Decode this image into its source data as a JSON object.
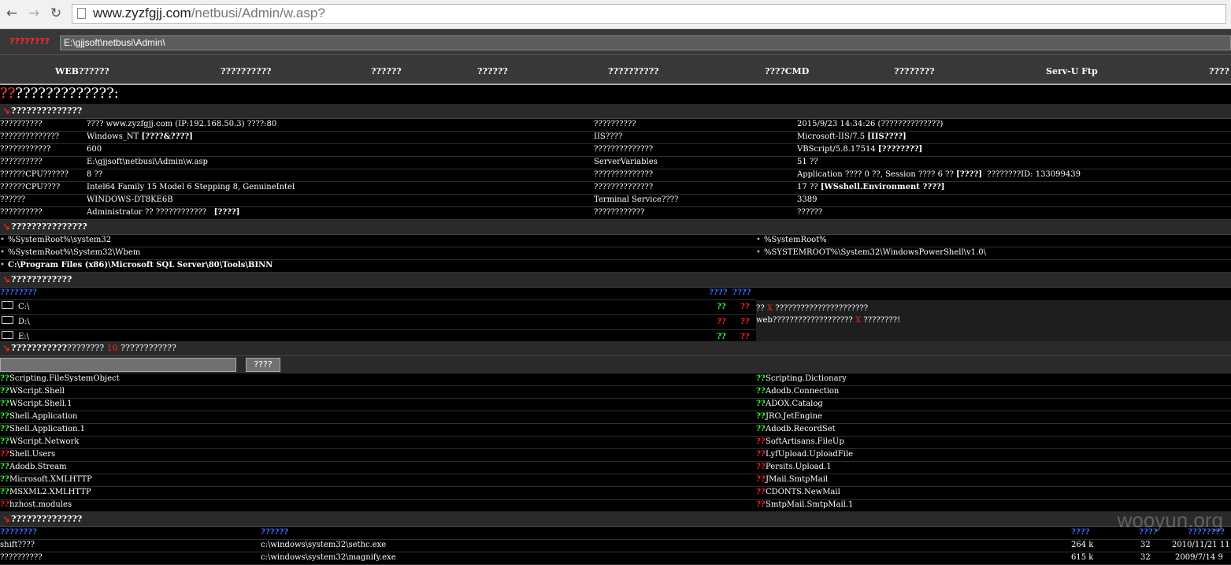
{
  "browser": {
    "url_host": "www.zyzfgjj.com",
    "url_path": "/netbusi/Admin/w.asp?"
  },
  "pathbar": {
    "label": "????????",
    "value": "E:\\gjjsoft\\netbusi\\Admin\\"
  },
  "menu": [
    "WEB??????",
    "??????????",
    "??????",
    "??????",
    "??????????",
    "????CMD",
    "????????",
    "Serv-U Ftp",
    "????"
  ],
  "page_title": {
    "text": "???????????????:",
    "suffix": "??"
  },
  "section1": {
    "title": "??????????????",
    "rows": [
      {
        "k1": "??????????",
        "v1": "???? www.zyzfgjj.com (IP:192.168.50.3) ????:80",
        "v1b": "",
        "k2": "??????????",
        "v2": "2015/9/23 14:34:26 (??????????????)",
        "v2b": ""
      },
      {
        "k1": "??????????????",
        "v1": "Windows_NT ",
        "v1b": "[????&????]",
        "k2": "IIS????",
        "v2": "Microsoft-IIS/7.5 ",
        "v2b": "[IIS????]"
      },
      {
        "k1": "????????????",
        "v1": "600",
        "v1b": "",
        "k2": "??????????????",
        "v2": "VBScript/5.8.17514 ",
        "v2b": "[????????]"
      },
      {
        "k1": "??????????",
        "v1": "E:\\gjjsoft\\netbusi\\Admin\\w.asp",
        "v1b": "",
        "k2": "ServerVariables",
        "v2": "51 ??",
        "v2b": ""
      },
      {
        "k1": "??????CPU??????",
        "v1": "8 ??",
        "v1b": "",
        "k2": "??????????????",
        "v2": "Application ???? 0 ??, Session ???? 6 ?? ",
        "v2b": "[????]",
        "v2c": "  ????????ID: 133099439"
      },
      {
        "k1": "??????CPU????",
        "v1": "Intel64 Family 15 Model 6 Stepping 8, GenuineIntel",
        "v1b": "",
        "k2": "??????????????",
        "v2": "17 ?? ",
        "v2b": "[WSshell.Environment ????]"
      },
      {
        "k1": "??????",
        "v1": "WINDOWS-DT8KE6B",
        "v1b": "",
        "k2": "Terminal Service????",
        "v2": "3389",
        "v2b": ""
      },
      {
        "k1": "??????????",
        "v1": "Administrator ?? ????????????   ",
        "v1b": "[????]",
        "k2": "????????????",
        "v2": "??????",
        "v2b": ""
      }
    ]
  },
  "section2": {
    "title": "???????????????",
    "rows": [
      {
        "left": "%SystemRoot%\\system32",
        "right": "%SystemRoot%"
      },
      {
        "left": "%SystemRoot%\\System32\\Wbem",
        "right": "%SYSTEMROOT%\\System32\\WindowsPowerShell\\v1.0\\"
      }
    ],
    "bold_row": "C:\\Program Files (x86)\\Microsoft SQL Server\\80\\Tools\\BINN"
  },
  "section3": {
    "title": "????????????",
    "header_left": "????????",
    "header_mid1": "????",
    "header_mid2": "????",
    "drives": [
      {
        "name": "C:\\",
        "s1": "??",
        "s2": "??",
        "s1ok": true
      },
      {
        "name": "D:\\",
        "s1": "??",
        "s2": "??",
        "s1ok": false
      },
      {
        "name": "E:\\",
        "s1": "??",
        "s2": "??",
        "s1ok": true
      }
    ],
    "note1_a": "?? ",
    "note1_b": "X",
    "note1_c": " ??????????????????????",
    "note2_a": "web??????????????????? ",
    "note2_b": "X",
    "note2_c": " ????????!"
  },
  "section4": {
    "title": "???????????",
    "title_rest": "????????",
    "count": "10",
    "title_tail": " ????????????",
    "search_button": "????"
  },
  "components": {
    "left": [
      {
        "st": "??",
        "ok": true,
        "name": "Scripting.FileSystemObject"
      },
      {
        "st": "??",
        "ok": true,
        "name": "WScript.Shell"
      },
      {
        "st": "??",
        "ok": true,
        "name": "WScript.Shell.1"
      },
      {
        "st": "??",
        "ok": true,
        "name": "Shell.Application"
      },
      {
        "st": "??",
        "ok": true,
        "name": "Shell.Application.1"
      },
      {
        "st": "??",
        "ok": true,
        "name": "WScript.Network"
      },
      {
        "st": "??",
        "ok": false,
        "name": "Shell.Users"
      },
      {
        "st": "??",
        "ok": true,
        "name": "Adodb.Stream"
      },
      {
        "st": "??",
        "ok": true,
        "name": "Microsoft.XMLHTTP"
      },
      {
        "st": "??",
        "ok": true,
        "name": "MSXML2.XMLHTTP"
      },
      {
        "st": "??",
        "ok": false,
        "name": "hzhost.modules"
      }
    ],
    "right": [
      {
        "st": "??",
        "ok": true,
        "name": "Scripting.Dictionary"
      },
      {
        "st": "??",
        "ok": true,
        "name": "Adodb.Connection"
      },
      {
        "st": "??",
        "ok": true,
        "name": "ADOX.Catalog"
      },
      {
        "st": "??",
        "ok": true,
        "name": "JRO.JetEngine"
      },
      {
        "st": "??",
        "ok": true,
        "name": "Adodb.RecordSet"
      },
      {
        "st": "??",
        "ok": false,
        "name": "SoftArtisans.FileUp"
      },
      {
        "st": "??",
        "ok": false,
        "name": "LyfUpload.UploadFile"
      },
      {
        "st": "??",
        "ok": false,
        "name": "Persits.Upload.1"
      },
      {
        "st": "??",
        "ok": false,
        "name": "JMail.SmtpMail"
      },
      {
        "st": "??",
        "ok": false,
        "name": "CDONTS.NewMail"
      },
      {
        "st": "??",
        "ok": false,
        "name": "SmtpMail.SmtpMail.1"
      }
    ]
  },
  "section5": {
    "title": "??????????????",
    "headers": [
      "????????",
      "??????",
      "????",
      "????",
      "????????"
    ],
    "rows": [
      {
        "name": "shift????",
        "path": "c:\\windows\\system32\\sethc.exe",
        "size": "264 k",
        "bits": "32",
        "date": "2010/11/21 11"
      },
      {
        "name": "??????????",
        "path": "c:\\windows\\system32\\magnify.exe",
        "size": "615 k",
        "bits": "32",
        "date": "2009/7/14 9"
      }
    ]
  },
  "watermark": "wooyun.org"
}
